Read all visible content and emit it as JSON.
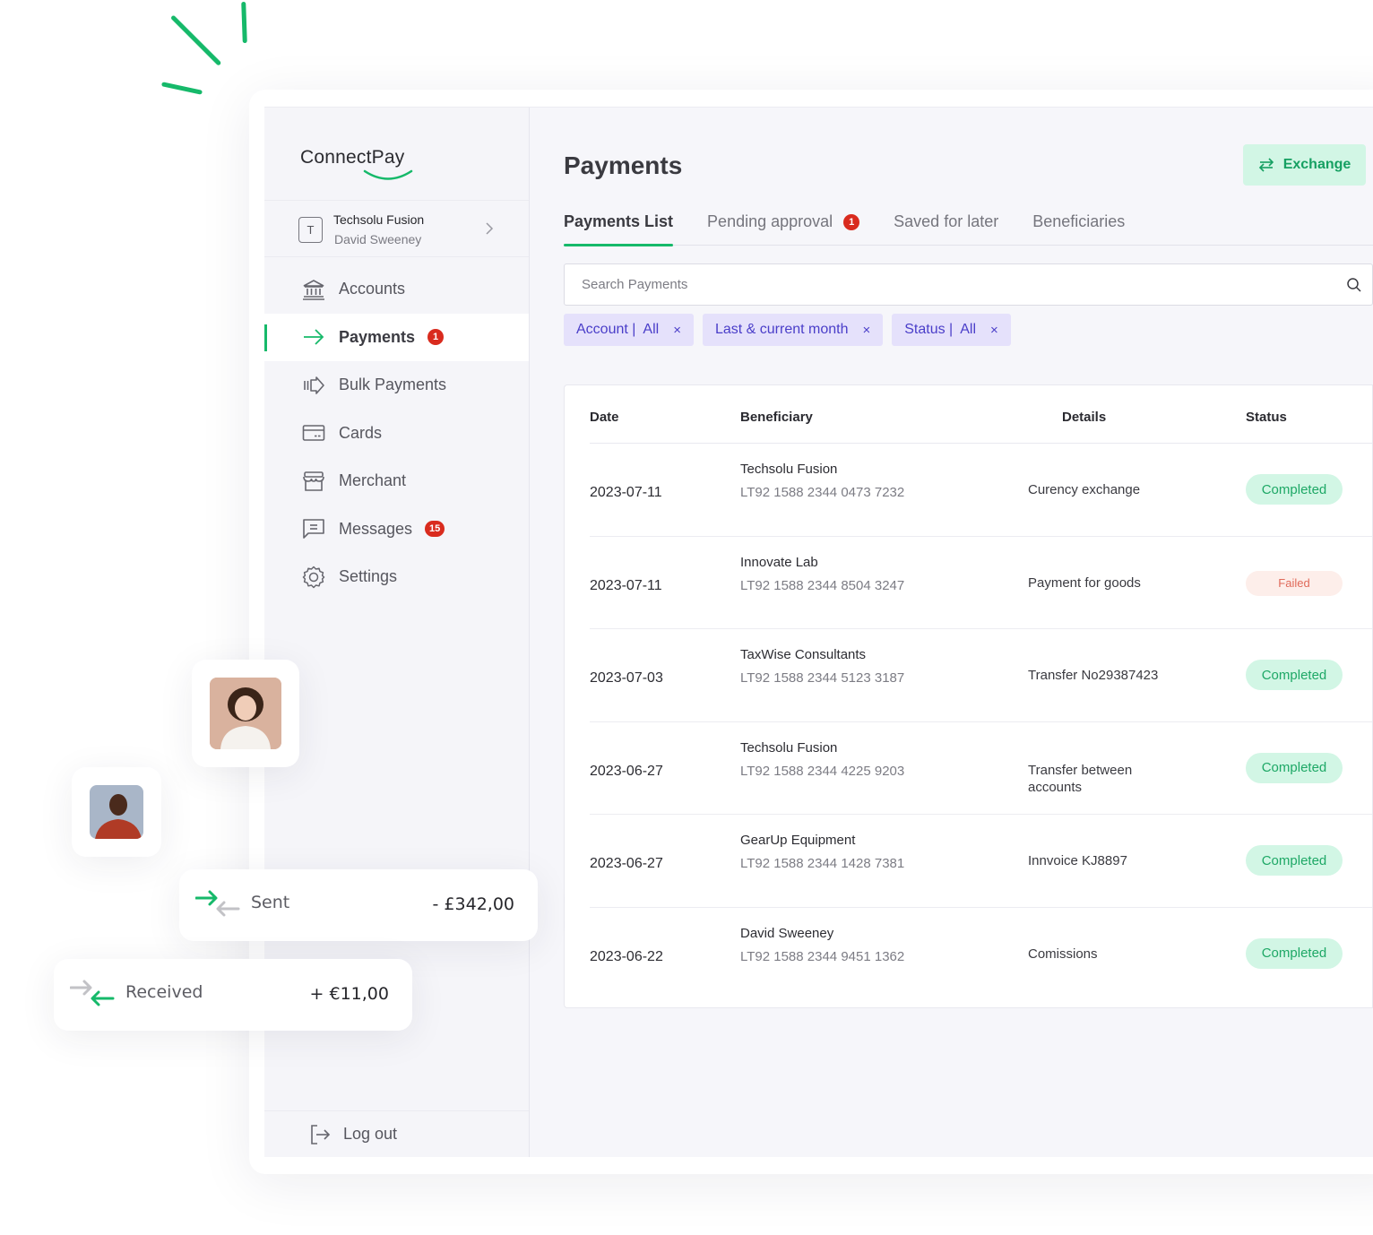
{
  "brand": {
    "name": "ConnectPay",
    "accent": "#16b96a"
  },
  "org": {
    "avatar_letter": "T",
    "company": "Techsolu Fusion",
    "user": "David Sweeney"
  },
  "sidebar": {
    "items": [
      {
        "label": "Accounts",
        "icon": "bank-icon"
      },
      {
        "label": "Payments",
        "icon": "arrow-right-icon",
        "badge": "1",
        "active": true
      },
      {
        "label": "Bulk Payments",
        "icon": "bulk-arrow-icon"
      },
      {
        "label": "Cards",
        "icon": "card-icon"
      },
      {
        "label": "Merchant",
        "icon": "store-icon"
      },
      {
        "label": "Messages",
        "icon": "message-icon",
        "badge": "15"
      },
      {
        "label": "Settings",
        "icon": "gear-icon"
      }
    ],
    "logout_label": "Log out"
  },
  "main": {
    "title": "Payments",
    "exchange_label": "Exchange",
    "tabs": [
      {
        "label": "Payments List",
        "active": true
      },
      {
        "label": "Pending approval",
        "badge": "1"
      },
      {
        "label": "Saved for later"
      },
      {
        "label": "Beneficiaries"
      }
    ],
    "search": {
      "placeholder": "Search Payments",
      "value": ""
    },
    "filters": [
      {
        "label": "Account |  All"
      },
      {
        "label": "Last & current month"
      },
      {
        "label": "Status |  All"
      }
    ],
    "filter_remove_glyph": "×",
    "table": {
      "headers": {
        "date": "Date",
        "beneficiary": "Beneficiary",
        "details": "Details",
        "status": "Status"
      },
      "rows": [
        {
          "date": "2023-07-11",
          "name": "Techsolu Fusion",
          "iban": "LT92 1588 2344 0473 7232",
          "details": "Curency exchange",
          "status": "Completed"
        },
        {
          "date": "2023-07-11",
          "name": "Innovate Lab",
          "iban": "LT92 1588 2344 8504 3247",
          "details": "Payment for goods",
          "status": "Failed"
        },
        {
          "date": "2023-07-03",
          "name": "TaxWise Consultants",
          "iban": "LT92 1588 2344 5123 3187",
          "details": "Transfer No29387423",
          "status": "Completed"
        },
        {
          "date": "2023-06-27",
          "name": "Techsolu Fusion",
          "iban": "LT92 1588 2344 4225 9203",
          "details": "Transfer between accounts",
          "status": "Completed"
        },
        {
          "date": "2023-06-27",
          "name": "GearUp Equipment",
          "iban": "LT92 1588 2344 1428 7381",
          "details": "Innvoice KJ8897",
          "status": "Completed"
        },
        {
          "date": "2023-06-22",
          "name": "David Sweeney",
          "iban": "LT92 1588 2344 9451 1362",
          "details": "Comissions",
          "status": "Completed"
        }
      ]
    }
  },
  "floating": {
    "sent": {
      "label": "Sent",
      "amount": "- £342,00"
    },
    "received": {
      "label": "Received",
      "amount": "+ €11,00"
    }
  }
}
